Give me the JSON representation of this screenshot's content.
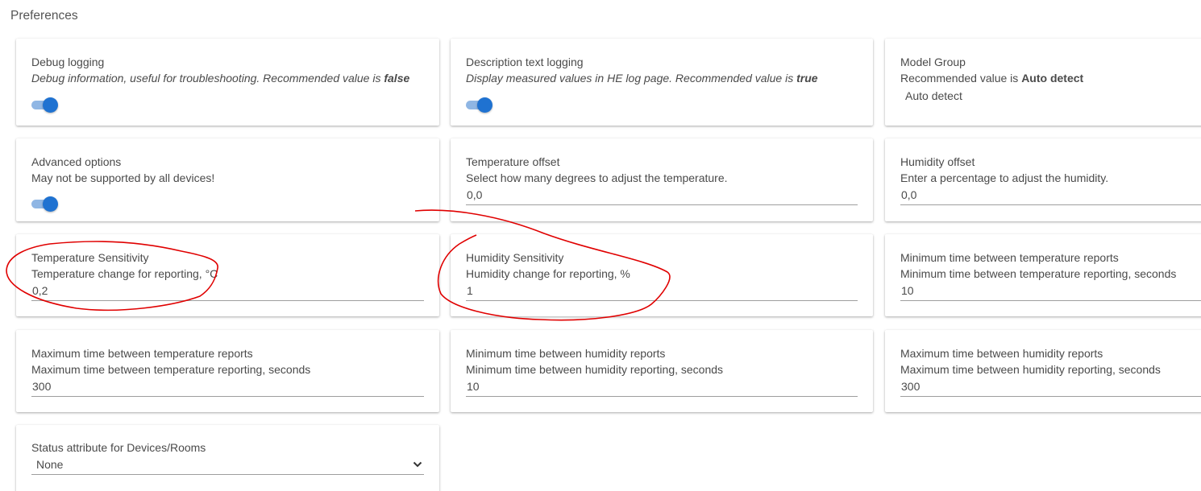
{
  "section_title": "Preferences",
  "debug_logging": {
    "label": "Debug logging",
    "desc_prefix": "Debug information, useful for troubleshooting. Recommended value is ",
    "desc_bold": "false",
    "toggle_on": true
  },
  "description_text_logging": {
    "label": "Description text logging",
    "desc_prefix": "Display measured values in HE log page. Recommended value is ",
    "desc_bold": "true",
    "toggle_on": true
  },
  "model_group": {
    "label": "Model Group",
    "desc_prefix": "Recommended value is ",
    "desc_bold": "Auto detect",
    "value": "Auto detect"
  },
  "advanced_options": {
    "label": "Advanced options",
    "desc": "May not be supported by all devices!",
    "toggle_on": true
  },
  "temperature_offset": {
    "label": "Temperature offset",
    "desc": "Select how many degrees to adjust the temperature.",
    "value": "0,0"
  },
  "humidity_offset": {
    "label": "Humidity offset",
    "desc": "Enter a percentage to adjust the humidity.",
    "value": "0,0"
  },
  "temperature_sensitivity": {
    "label": "Temperature Sensitivity",
    "desc": "Temperature change for reporting, °C",
    "value": "0,2"
  },
  "humidity_sensitivity": {
    "label": "Humidity Sensitivity",
    "desc": "Humidity change for reporting, %",
    "value": "1"
  },
  "min_temp_reports": {
    "label": "Minimum time between temperature reports",
    "desc": "Minimum time between temperature reporting, seconds",
    "value": "10"
  },
  "max_temp_reports": {
    "label": "Maximum time between temperature reports",
    "desc": "Maximum time between temperature reporting, seconds",
    "value": "300"
  },
  "min_humidity_reports": {
    "label": "Minimum time between humidity reports",
    "desc": "Minimum time between humidity reporting, seconds",
    "value": "10"
  },
  "max_humidity_reports": {
    "label": "Maximum time between humidity reports",
    "desc": "Maximum time between humidity reporting, seconds",
    "value": "300"
  },
  "status_attribute": {
    "label": "Status attribute for Devices/Rooms",
    "value": "None"
  },
  "colors": {
    "toggle_track": "#8fb6e4",
    "toggle_knob": "#1f72d1",
    "annotation_red": "#e00000"
  },
  "icons": {
    "select_chevron": "chevron-down-icon"
  }
}
